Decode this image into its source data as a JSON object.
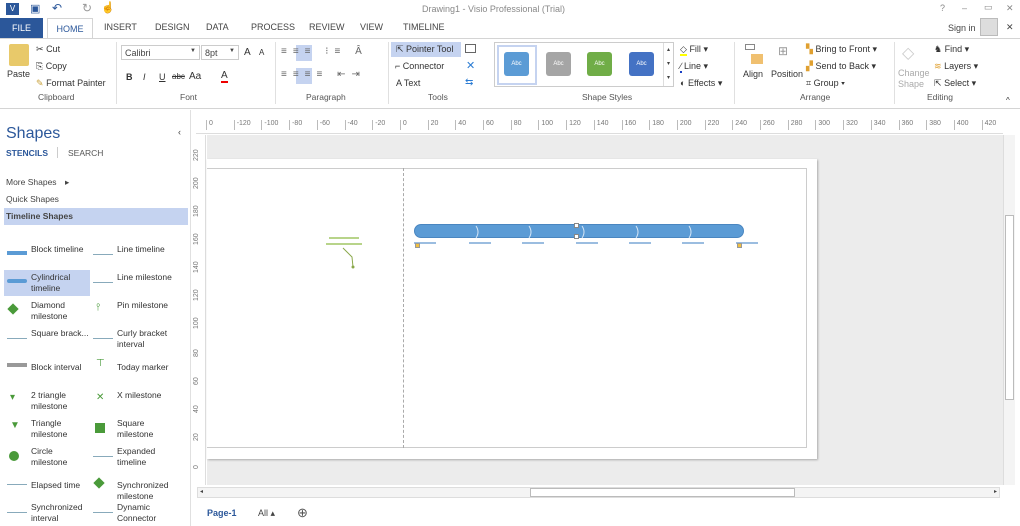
{
  "title": "Drawing1 - Visio Professional (Trial)",
  "window": {
    "help": "?",
    "minimize": "–",
    "restore": "▭",
    "close": "✕"
  },
  "account": {
    "sign_in": "Sign in",
    "close": "✕"
  },
  "tabs": [
    "FILE",
    "HOME",
    "INSERT",
    "DESIGN",
    "DATA",
    "PROCESS",
    "REVIEW",
    "VIEW",
    "TIMELINE"
  ],
  "ribbon": {
    "clipboard": {
      "paste": "Paste",
      "cut": "Cut",
      "copy": "Copy",
      "format_painter": "Format Painter",
      "label": "Clipboard"
    },
    "font": {
      "family": "Calibri",
      "size": "8pt",
      "bold": "B",
      "italic": "I",
      "underline": "U",
      "strike": "abc",
      "case": "Aa",
      "label": "Font"
    },
    "paragraph": {
      "label": "Paragraph"
    },
    "tools": {
      "pointer": "Pointer Tool",
      "connector": "Connector",
      "text": "Text",
      "label": "Tools"
    },
    "shape_styles": {
      "swatches": [
        {
          "text": "Abc",
          "color": "#5b9bd5"
        },
        {
          "text": "Abc",
          "color": "#a5a5a5"
        },
        {
          "text": "Abc",
          "color": "#70ad47"
        },
        {
          "text": "Abc",
          "color": "#4472c4"
        }
      ],
      "fill": "Fill",
      "line": "Line",
      "effects": "Effects",
      "label": "Shape Styles"
    },
    "arrange": {
      "align": "Align",
      "position": "Position",
      "bring_front": "Bring to Front",
      "send_back": "Send to Back",
      "group": "Group",
      "label": "Arrange"
    },
    "editing": {
      "change_shape": "Change Shape",
      "find": "Find",
      "layers": "Layers",
      "select": "Select",
      "label": "Editing"
    }
  },
  "shapes_pane": {
    "title": "Shapes",
    "stencils": "STENCILS",
    "search": "SEARCH",
    "more": "More Shapes",
    "quick": "Quick Shapes",
    "timeline": "Timeline Shapes",
    "items": [
      [
        "Block timeline",
        "Line timeline"
      ],
      [
        "Cylindrical timeline",
        "Line milestone"
      ],
      [
        "Diamond milestone",
        "Pin milestone"
      ],
      [
        "Square brack...",
        "Curly bracket interval"
      ],
      [
        "Block interval",
        "Today marker"
      ],
      [
        "2 triangle milestone",
        "X milestone"
      ],
      [
        "Triangle milestone",
        "Square milestone"
      ],
      [
        "Circle milestone",
        "Expanded timeline"
      ],
      [
        "Elapsed time",
        "Synchronized milestone"
      ],
      [
        "Synchronized interval",
        "Dynamic Connector"
      ]
    ]
  },
  "ruler": {
    "h": [
      "0",
      "-120",
      "-100",
      "-80",
      "-60",
      "-40",
      "-20",
      "0",
      "20",
      "40",
      "60",
      "80",
      "100",
      "120",
      "140",
      "160",
      "180",
      "200",
      "220",
      "240",
      "260",
      "280",
      "300",
      "320",
      "340",
      "360",
      "380",
      "400",
      "420"
    ],
    "v": [
      "220",
      "200",
      "180",
      "160",
      "140",
      "120",
      "100",
      "80",
      "60",
      "40",
      "20",
      "0"
    ]
  },
  "bottom": {
    "page": "Page-1",
    "all": "All ▴",
    "add": "⊕"
  },
  "colors": {
    "accent": "#2b579a",
    "timeline": "#5b9bd5",
    "selected": "#c5d3f0"
  }
}
